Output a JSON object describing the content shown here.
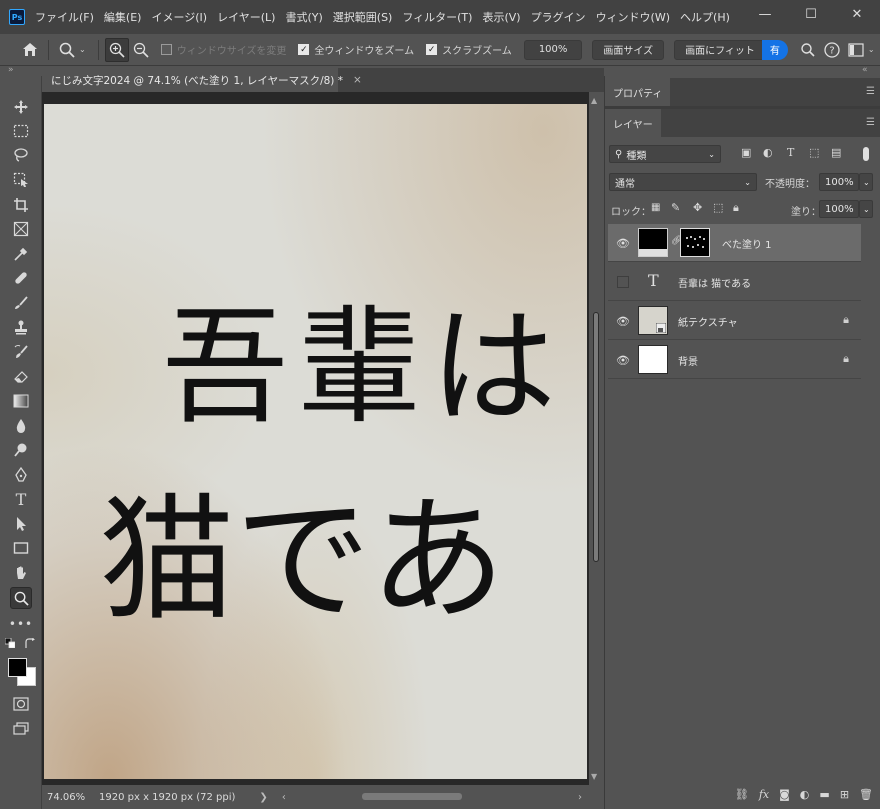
{
  "menubar": {
    "app_icon": "Ps",
    "items": [
      "ファイル(F)",
      "編集(E)",
      "イメージ(I)",
      "レイヤー(L)",
      "書式(Y)",
      "選択範囲(S)",
      "フィルター(T)",
      "表示(V)",
      "プラグイン",
      "ウィンドウ(W)",
      "ヘルプ(H)"
    ],
    "controls": {
      "minimize": "—",
      "maximize": "☐",
      "close": "✕"
    }
  },
  "options": {
    "resize_windows": "ウィンドウサイズを変更",
    "zoom_all": "全ウィンドウをズーム",
    "scrubby_zoom": "スクラブズーム",
    "zoom_value": "100%",
    "fit_screen": "画面サイズ",
    "fill_screen": "画面にフィット",
    "share": "有"
  },
  "document": {
    "tab_title": "にじみ文字2024 @ 74.1% (べた塗り 1, レイヤーマスク/8) *",
    "tab_close": "×",
    "line1": "吾輩は",
    "line2": "猫であ",
    "zoom": "74.06%",
    "info": "1920 px x 1920 px (72 ppi)",
    "info_arrow": "❯"
  },
  "panels": {
    "properties_tab": "プロパティ",
    "layers_tab": "レイヤー",
    "filter_kind": "種類",
    "blend_mode": "通常",
    "opacity_label": "不透明度：",
    "opacity_value": "100%",
    "lock_label": "ロック：",
    "fill_label": "塗り：",
    "fill_value": "100%"
  },
  "layers": [
    {
      "name": "べた塗り 1",
      "visible": true,
      "selected": true
    },
    {
      "name": "吾輩は 猫である",
      "visible": false,
      "selected": false
    },
    {
      "name": "紙テクスチャ",
      "visible": true,
      "selected": false
    },
    {
      "name": "背景",
      "visible": true,
      "selected": false
    }
  ],
  "colors": {
    "accent": "#1473e6",
    "panel_bg": "#535353",
    "dark_bg": "#424242",
    "canvas_bg": "#282828"
  }
}
